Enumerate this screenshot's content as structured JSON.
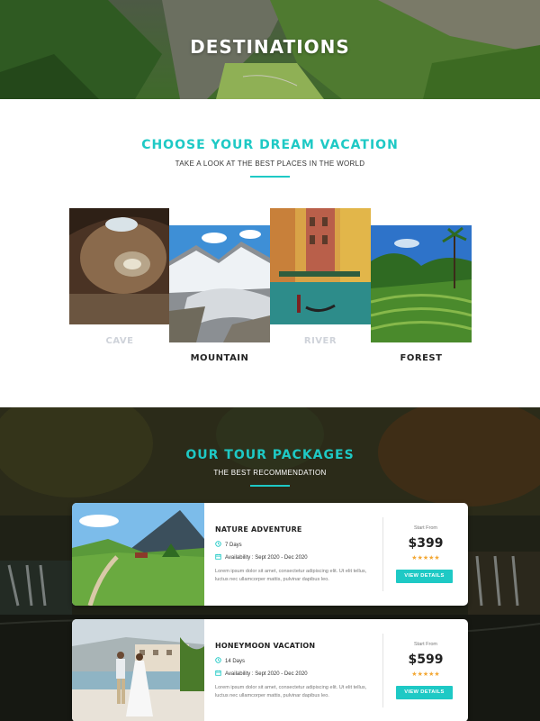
{
  "hero": {
    "title": "DESTINATIONS"
  },
  "dream": {
    "title": "CHOOSE YOUR DREAM VACATION",
    "subtitle": "TAKE A LOOK AT THE BEST PLACES IN THE WORLD",
    "destinations": [
      {
        "label": "CAVE",
        "style": "faded"
      },
      {
        "label": "MOUNTAIN",
        "style": "dark"
      },
      {
        "label": "RIVER",
        "style": "faded"
      },
      {
        "label": "FOREST",
        "style": "dark"
      }
    ]
  },
  "tours": {
    "title": "OUR TOUR PACKAGES",
    "subtitle": "THE BEST RECOMMENDATION",
    "packages": [
      {
        "name": "NATURE ADVENTURE",
        "duration": "7 Days",
        "availability": "Availability : Sept 2020 - Dec 2020",
        "description": "Lorem ipsum dolor sit amet, consectetur adipiscing elit. Ut elit tellus, luctus nec ullamcorper mattis, pulvinar dapibus leo.",
        "start_label": "Start From",
        "price": "$399",
        "stars": "★★★★★",
        "button": "VIEW DETAILS"
      },
      {
        "name": "HONEYMOON VACATION",
        "duration": "14 Days",
        "availability": "Availability : Sept 2020 - Dec 2020",
        "description": "Lorem ipsum dolor sit amet, consectetur adipiscing elit. Ut elit tellus, luctus nec ullamcorper mattis, pulvinar dapibus leo.",
        "start_label": "Start From",
        "price": "$599",
        "stars": "★★★★★",
        "button": "VIEW DETAILS"
      }
    ]
  },
  "colors": {
    "accent": "#1ec9c5",
    "star": "#f3a733",
    "faded_label": "#cfd3da"
  }
}
